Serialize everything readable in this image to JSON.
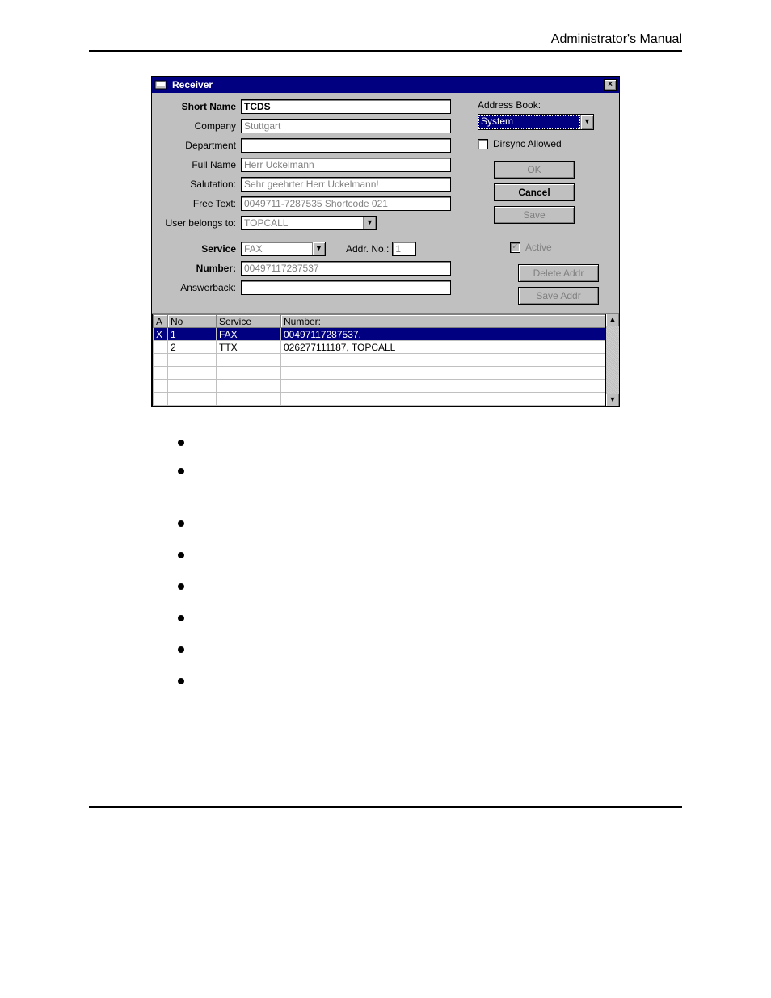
{
  "header": {
    "title": "Administrator's Manual"
  },
  "dialog": {
    "title": "Receiver",
    "labels": {
      "short_name": "Short Name",
      "company": "Company",
      "department": "Department",
      "full_name": "Full Name",
      "salutation": "Salutation:",
      "free_text": "Free Text:",
      "user_belongs_to": "User belongs to:",
      "service": "Service",
      "number": "Number:",
      "answerback": "Answerback:",
      "address_book": "Address Book:",
      "dirsync": "Dirsync Allowed",
      "addr_no": "Addr. No.:",
      "active": "Active"
    },
    "values": {
      "short_name": "TCDS",
      "company": "Stuttgart",
      "department": "",
      "full_name": "Herr Uckelmann",
      "salutation": "Sehr geehrter Herr Uckelmann!",
      "free_text": "0049711-7287535    Shortcode 021",
      "user_belongs_to": "TOPCALL",
      "address_book": "System",
      "dirsync_checked": false,
      "service": "FAX",
      "addr_no": "1",
      "number": "00497117287537",
      "answerback": "",
      "active_checked": true
    },
    "buttons": {
      "ok": "OK",
      "cancel": "Cancel",
      "save": "Save",
      "delete_addr": "Delete Addr",
      "save_addr": "Save Addr"
    },
    "grid": {
      "headers": {
        "a": "A",
        "no": "No",
        "service": "Service",
        "number": "Number:"
      },
      "rows": [
        {
          "a": "X",
          "no": "1",
          "service": "FAX",
          "number": "00497117287537,",
          "selected": true
        },
        {
          "a": "",
          "no": "2",
          "service": "TTX",
          "number": "026277111187, TOPCALL",
          "selected": false
        }
      ]
    }
  }
}
